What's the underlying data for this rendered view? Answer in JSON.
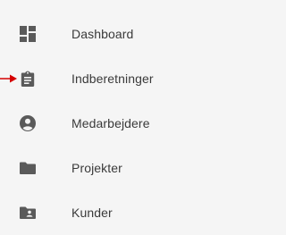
{
  "nav": {
    "items": [
      {
        "label": "Dashboard",
        "icon": "dashboard-icon"
      },
      {
        "label": "Indberetninger",
        "icon": "clipboard-icon"
      },
      {
        "label": "Medarbejdere",
        "icon": "account-circle-icon"
      },
      {
        "label": "Projekter",
        "icon": "folder-icon"
      },
      {
        "label": "Kunder",
        "icon": "contact-card-icon"
      }
    ]
  },
  "colors": {
    "background": "#f5f5f5",
    "icon": "#5a5a5a",
    "text": "#3a3a3a",
    "annotation_arrow": "#d50000"
  }
}
